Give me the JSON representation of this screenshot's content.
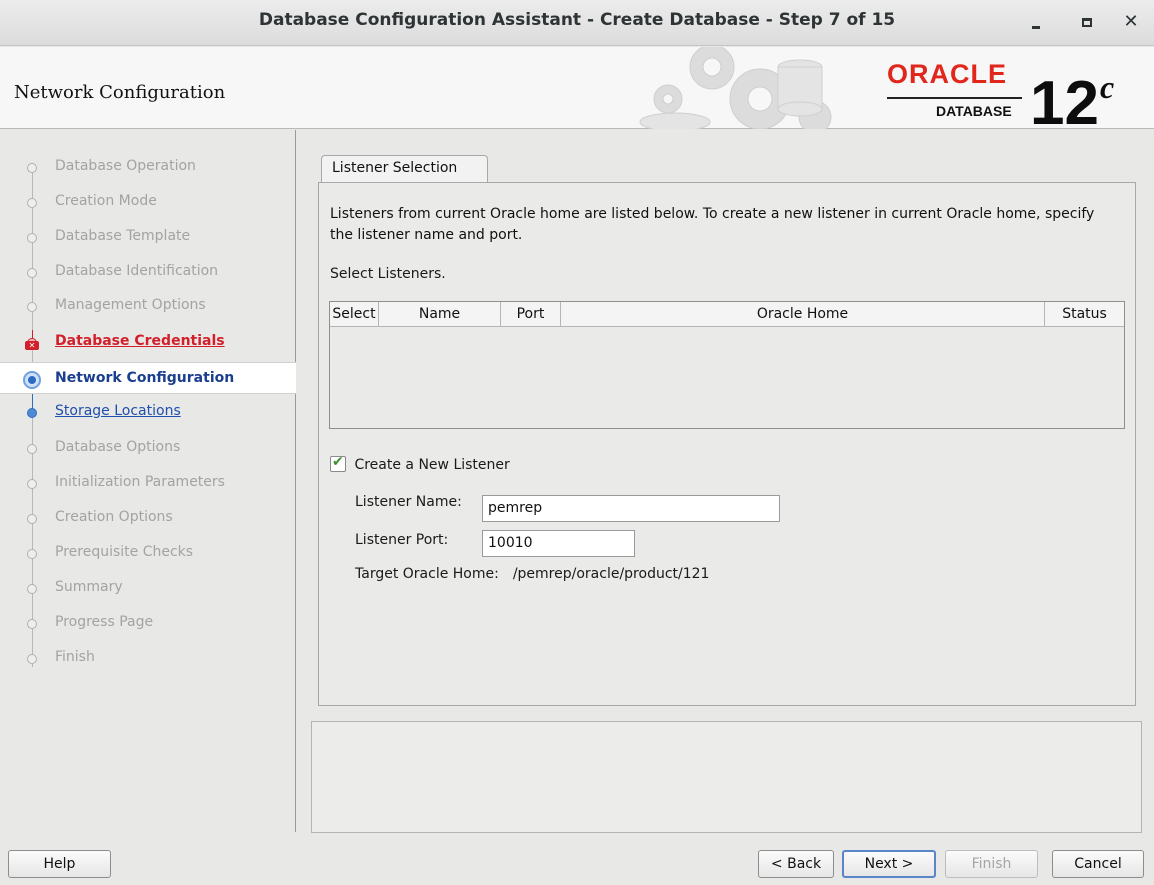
{
  "window": {
    "title": "Database Configuration Assistant - Create Database - Step 7 of 15"
  },
  "banner": {
    "page_title": "Network Configuration",
    "logo_oracle": "ORACLE",
    "logo_database": "DATABASE",
    "logo_version": "12",
    "logo_version_suffix": "c"
  },
  "nav": {
    "items": [
      {
        "label": "Database Operation",
        "state": "done"
      },
      {
        "label": "Creation Mode",
        "state": "done"
      },
      {
        "label": "Database Template",
        "state": "done"
      },
      {
        "label": "Database Identification",
        "state": "done"
      },
      {
        "label": "Management Options",
        "state": "done"
      },
      {
        "label": "Database Credentials",
        "state": "error"
      },
      {
        "label": "Network Configuration",
        "state": "current"
      },
      {
        "label": "Storage Locations",
        "state": "next"
      },
      {
        "label": "Database Options",
        "state": "pending"
      },
      {
        "label": "Initialization Parameters",
        "state": "pending"
      },
      {
        "label": "Creation Options",
        "state": "pending"
      },
      {
        "label": "Prerequisite Checks",
        "state": "pending"
      },
      {
        "label": "Summary",
        "state": "pending"
      },
      {
        "label": "Progress Page",
        "state": "pending"
      },
      {
        "label": "Finish",
        "state": "pending"
      }
    ]
  },
  "main": {
    "tab_label": "Listener Selection",
    "description": "Listeners from current Oracle home are listed below. To create a new listener in current Oracle home, specify the listener name and port.",
    "select_label": "Select Listeners.",
    "table": {
      "columns": [
        "Select",
        "Name",
        "Port",
        "Oracle Home",
        "Status"
      ],
      "rows": []
    },
    "create_listener_label": "Create a New Listener",
    "create_listener_checked": true,
    "listener_name_label": "Listener Name:",
    "listener_name_value": "pemrep",
    "listener_port_label": "Listener Port:",
    "listener_port_value": "10010",
    "target_home_label": "Target Oracle Home:",
    "target_home_value": "/pemrep/oracle/product/121"
  },
  "buttons": {
    "help": "Help",
    "back": "< Back",
    "next": "Next >",
    "finish": "Finish",
    "cancel": "Cancel"
  },
  "colors": {
    "error": "#d21f2a",
    "current": "#1b3f8f",
    "link": "#1f4fae",
    "oracle_red": "#e1261c"
  }
}
